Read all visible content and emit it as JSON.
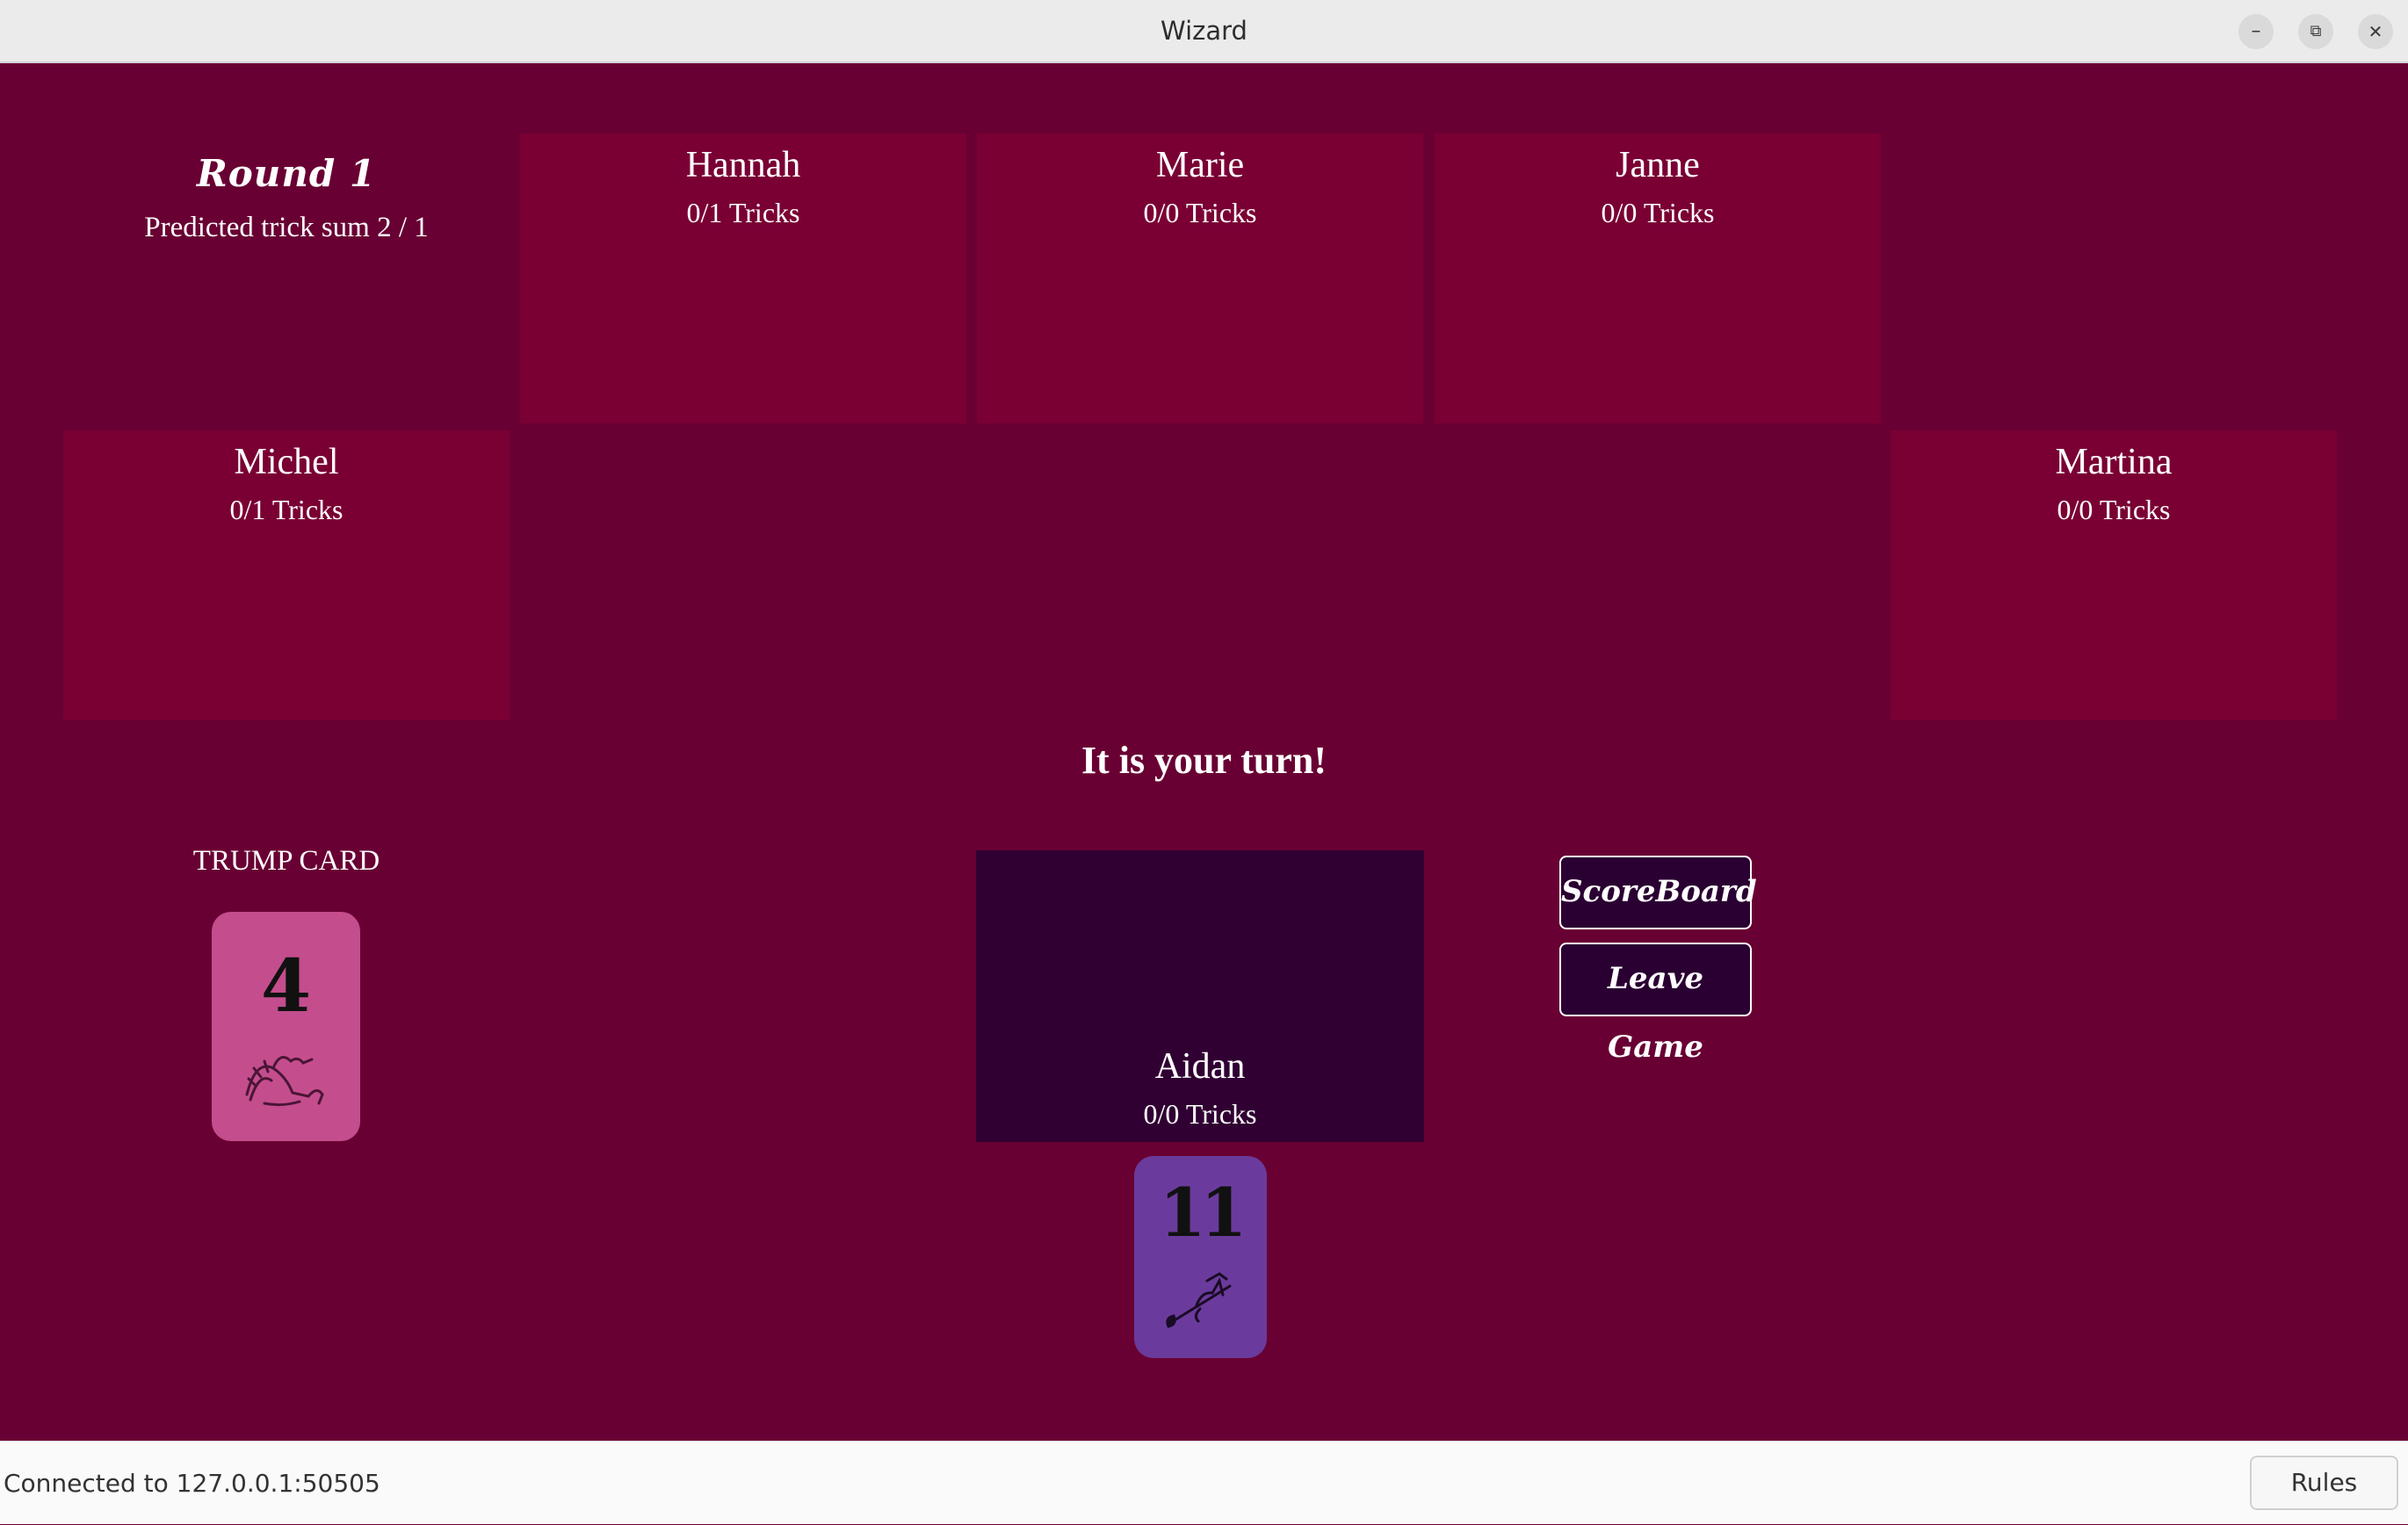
{
  "window": {
    "title": "Wizard",
    "controls": {
      "minimize": "–",
      "maximize": "⧉",
      "close": "✕"
    }
  },
  "round": {
    "label": "Round 1",
    "predicted": "Predicted trick sum 2 / 1"
  },
  "opponents": [
    {
      "name": "Hannah",
      "tricks": "0/1 Tricks"
    },
    {
      "name": "Marie",
      "tricks": "0/0 Tricks"
    },
    {
      "name": "Janne",
      "tricks": "0/0 Tricks"
    },
    {
      "name": "Michel",
      "tricks": "0/1 Tricks"
    },
    {
      "name": "Martina",
      "tricks": "0/0 Tricks"
    }
  ],
  "turn_message": "It is your turn!",
  "trump": {
    "label": "TRUMP CARD",
    "value": "4",
    "color": "#c44d8e",
    "icon": "dragon-icon"
  },
  "me": {
    "name": "Aidan",
    "tricks": "0/0 Tricks"
  },
  "hand": [
    {
      "value": "11",
      "color": "#6a3b9c",
      "icon": "witch-on-broom-icon"
    }
  ],
  "buttons": {
    "scoreboard": "ScoreBoard",
    "leave": "Leave Game"
  },
  "status": {
    "connection": "Connected to 127.0.0.1:50505",
    "rules": "Rules"
  },
  "colors": {
    "background": "#690033",
    "opponent_panel": "#7a0034",
    "own_panel": "#310033",
    "button": "#2a0032"
  }
}
